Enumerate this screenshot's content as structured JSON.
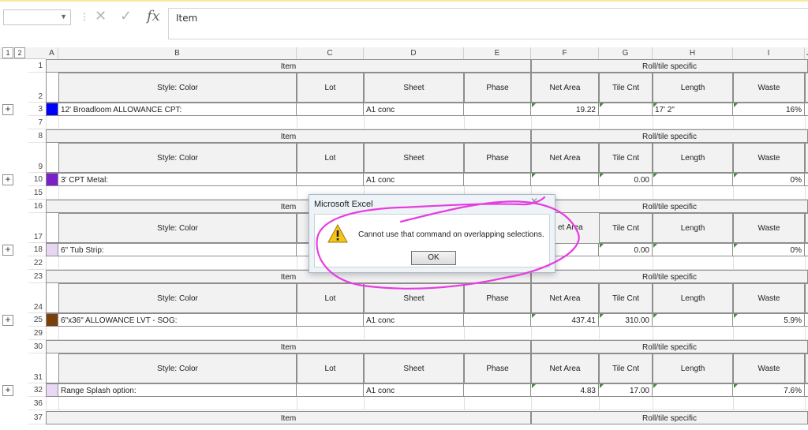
{
  "formula_bar": {
    "value": "Item",
    "fx_label": "fx"
  },
  "outline_levels": [
    "1",
    "2"
  ],
  "columns": [
    "A",
    "B",
    "C",
    "D",
    "E",
    "F",
    "G",
    "H",
    "I",
    "J"
  ],
  "header_labels": {
    "item": "Item",
    "roll_tile": "Roll/tile specific",
    "style_color": "Style: Color",
    "lot": "Lot",
    "sheet": "Sheet",
    "phase": "Phase",
    "net_area": "Net Area",
    "tile_cnt": "Tile Cnt",
    "length": "Length",
    "waste": "Waste"
  },
  "groups": [
    {
      "rows": [
        "1",
        "2",
        "3",
        "7"
      ],
      "name": "12' Broadloom ALLOWANCE CPT:",
      "color": "#0000ff",
      "sheet": "A1 conc",
      "net_area": "19.22",
      "tile_cnt": "",
      "length": "17' 2\"",
      "waste": "16%"
    },
    {
      "rows": [
        "8",
        "9",
        "10",
        "15"
      ],
      "name": "3' CPT Metal:",
      "color": "#7a1fc9",
      "sheet": "A1 conc",
      "net_area": "",
      "tile_cnt": "0.00",
      "length": "",
      "waste": "0%"
    },
    {
      "rows": [
        "16",
        "17",
        "18",
        "22"
      ],
      "name": "6\" Tub Strip:",
      "color": "#e6d6f2",
      "sheet": "",
      "net_area": "",
      "tile_cnt": "0.00",
      "length": "",
      "waste": "0%"
    },
    {
      "rows": [
        "23",
        "24",
        "25",
        "29"
      ],
      "name": "6\"x36\" ALLOWANCE LVT - SOG:",
      "color": "#7a3f0c",
      "sheet": "A1 conc",
      "net_area": "437.41",
      "tile_cnt": "310.00",
      "length": "",
      "waste": "5.9%"
    },
    {
      "rows": [
        "30",
        "31",
        "32",
        "36"
      ],
      "name": "Range Splash option:",
      "color": "#e8d8f5",
      "sheet": "A1 conc",
      "net_area": "4.83",
      "tile_cnt": "17.00",
      "length": "",
      "waste": "7.6%"
    },
    {
      "rows": [
        "37"
      ],
      "name": "",
      "color": "",
      "sheet": "",
      "net_area": "",
      "tile_cnt": "",
      "length": "",
      "waste": ""
    }
  ],
  "dialog": {
    "title": "Microsoft Excel",
    "message": "Cannot use that command on overlapping selections.",
    "ok_label": "OK",
    "partial_header": "et Area"
  },
  "annotation_color": "#e63de0"
}
